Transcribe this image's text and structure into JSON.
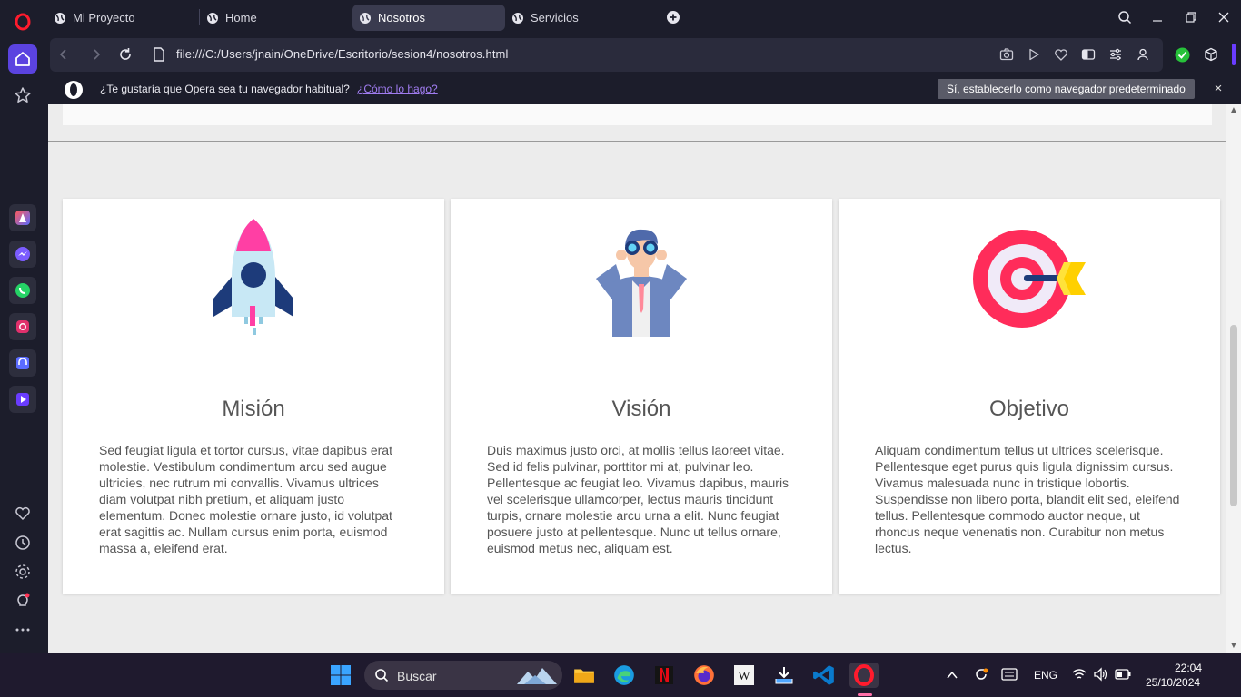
{
  "browser": {
    "tabs": [
      {
        "label": "Mi Proyecto"
      },
      {
        "label": "Home"
      },
      {
        "label": "Nosotros"
      },
      {
        "label": "Servicios"
      }
    ],
    "url": "file:///C:/Users/jnain/OneDrive/Escritorio/sesion4/nosotros.html",
    "infobar": {
      "message": "¿Te gustaría que Opera sea tu navegador habitual?",
      "link": "¿Cómo lo hago?",
      "button": "Sí, establecerlo como navegador predeterminado",
      "close": "×"
    }
  },
  "page": {
    "cards": [
      {
        "icon": "rocket-icon",
        "title": "Misión",
        "text": "Sed feugiat ligula et tortor cursus, vitae dapibus erat molestie. Vestibulum condimentum arcu sed augue ultricies, nec rutrum mi convallis. Vivamus ultrices diam volutpat nibh pretium, et aliquam justo elementum. Donec molestie ornare justo, id volutpat erat sagittis ac. Nullam cursus enim porta, euismod massa a, eleifend erat."
      },
      {
        "icon": "binoculars-man-icon",
        "title": "Visión",
        "text": "Duis maximus justo orci, at mollis tellus laoreet vitae. Sed id felis pulvinar, porttitor mi at, pulvinar leo. Pellentesque ac feugiat leo. Vivamus dapibus, mauris vel scelerisque ullamcorper, lectus mauris tincidunt turpis, ornare molestie arcu urna a elit. Nunc feugiat posuere justo at pellentesque. Nunc ut tellus ornare, euismod metus nec, aliquam est."
      },
      {
        "icon": "target-icon",
        "title": "Objetivo",
        "text": "Aliquam condimentum tellus ut ultrices scelerisque. Pellentesque eget purus quis ligula dignissim cursus. Vivamus malesuada nunc in tristique lobortis. Suspendisse non libero porta, blandit elit sed, eleifend tellus. Pellentesque commodo auctor neque, ut rhoncus neque venenatis non. Curabitur non metus lectus."
      }
    ]
  },
  "taskbar": {
    "search_placeholder": "Buscar",
    "language": "ENG",
    "time": "22:04",
    "date": "25/10/2024"
  },
  "colors": {
    "accent": "#5b43e0",
    "opera_red": "#ff1b2d",
    "card_bg": "#ffffff",
    "page_bg": "#ececec"
  }
}
